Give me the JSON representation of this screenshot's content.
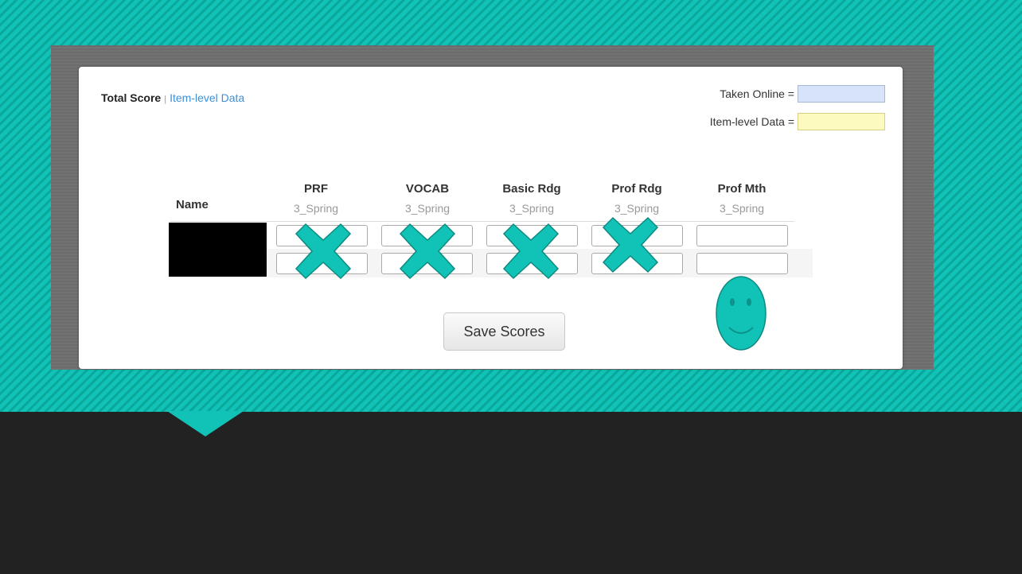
{
  "tabs": {
    "active": "Total Score",
    "separator": "|",
    "link": "Item-level Data"
  },
  "legend": [
    {
      "label": "Taken Online =",
      "color": "#d7e3f8"
    },
    {
      "label": "Item-level Data =",
      "color": "#fdfac0"
    }
  ],
  "table": {
    "name_header": "Name",
    "columns": [
      {
        "title": "PRF",
        "term": "3_Spring"
      },
      {
        "title": "VOCAB",
        "term": "3_Spring"
      },
      {
        "title": "Basic Rdg",
        "term": "3_Spring"
      },
      {
        "title": "Prof Rdg",
        "term": "3_Spring"
      },
      {
        "title": "Prof Mth",
        "term": "3_Spring"
      }
    ],
    "rows": [
      {
        "name": "",
        "scores": [
          "",
          "",
          "",
          "",
          ""
        ]
      },
      {
        "name": "",
        "scores": [
          "",
          "",
          "",
          "",
          ""
        ]
      }
    ]
  },
  "save_button": "Save Scores",
  "overlays": {
    "x_mark_icon": "x-mark-icon",
    "smiley_icon": "smiley-face-icon",
    "accent_color": "#11c3b6"
  }
}
